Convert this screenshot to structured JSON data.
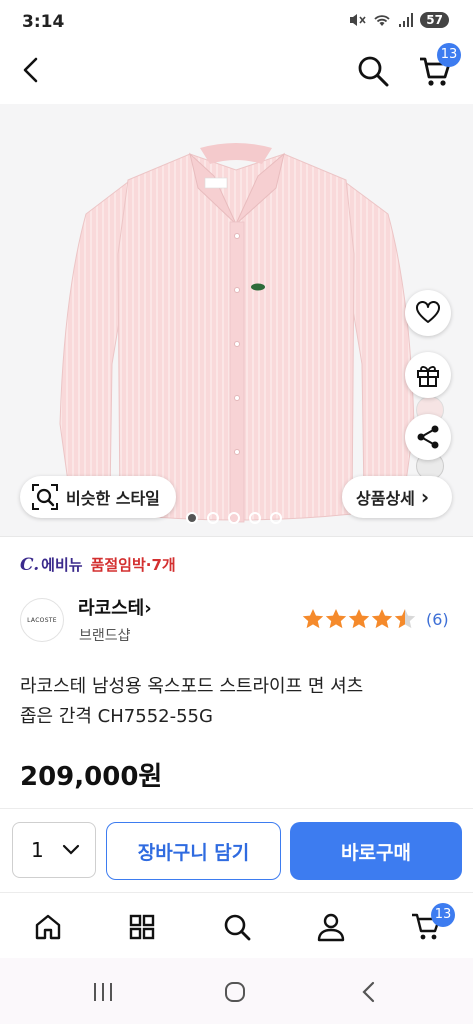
{
  "status_bar": {
    "time": "3:14",
    "battery": "57"
  },
  "header": {
    "cart_count": "13"
  },
  "gallery": {
    "similar_style_label": "비슷한 스타일",
    "product_detail_label": "상품상세",
    "detail_chevron": "›",
    "logo_text": "LACOSTE",
    "dots": 5,
    "active_dot": 1
  },
  "seller": {
    "logo_text": "C.",
    "name": "에비뉴",
    "badge": "품절임박·7개",
    "badge_color": "#d32f2f"
  },
  "brand": {
    "name": "라코스테",
    "chevron": "›",
    "subtitle": "브랜드샵",
    "logo_text": "LACOSTE"
  },
  "rating": {
    "stars": 4.5,
    "star_color": "#f58a2b",
    "review_count": "(6)"
  },
  "product": {
    "title_line1": "라코스테 남성용 옥스포드 스트라이프 면 셔츠",
    "title_line2": "좁은 간격 CH7552-55G",
    "price": "209,000원"
  },
  "buy_bar": {
    "quantity": "1",
    "add_to_cart": "장바구니 담기",
    "buy_now": "바로구매",
    "accent": "#3d7cf0"
  },
  "tab_bar": {
    "cart_count": "13"
  },
  "icons": [
    "back-icon",
    "search-icon",
    "cart-icon",
    "heart-icon",
    "gift-icon",
    "share-icon",
    "image-search-icon",
    "home-icon",
    "category-icon",
    "user-icon"
  ]
}
